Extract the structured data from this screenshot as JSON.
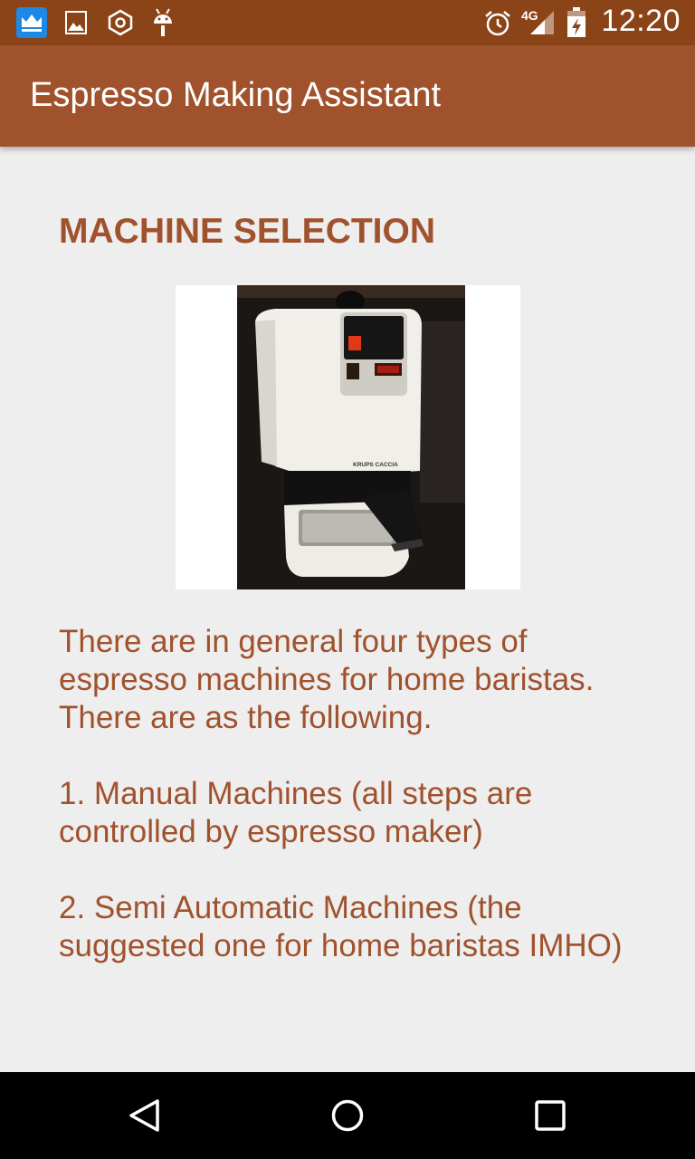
{
  "status_bar": {
    "time": "12:20",
    "network": "4G",
    "left_icons": [
      "crown-app-icon",
      "image-icon",
      "hexagon-settings-icon",
      "android-debug-icon"
    ],
    "right_icons": [
      "alarm-icon",
      "signal-icon",
      "battery-charging-icon"
    ]
  },
  "app_bar": {
    "title": "Espresso Making Assistant",
    "color": "#a0522d"
  },
  "content": {
    "section_title": "MACHINE SELECTION",
    "image_caption_text": "KRUPS CACCIA",
    "paragraphs": [
      "There are in general four types of espresso machines for home baristas. There are as the following.",
      "1. Manual Machines (all steps are controlled by espresso maker)",
      "2. Semi Automatic Machines (the suggested one for home baristas IMHO)"
    ]
  },
  "nav_bar": {
    "buttons": [
      "back-icon",
      "home-icon",
      "recents-icon"
    ]
  }
}
